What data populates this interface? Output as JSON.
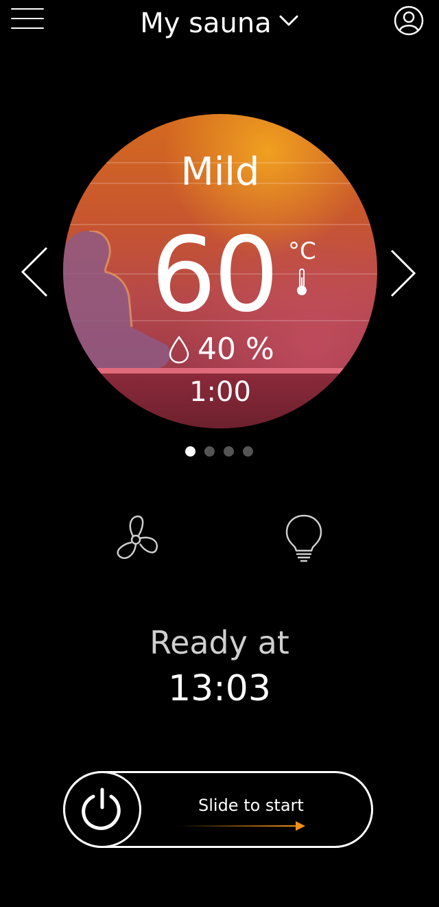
{
  "header": {
    "title": "My sauna",
    "menu_icon": "hamburger-menu-icon",
    "dropdown_icon": "chevron-down-icon",
    "profile_icon": "user-profile-icon"
  },
  "preset": {
    "mode": "Mild",
    "temperature": "60",
    "temperature_unit": "°C",
    "humidity": "40 %",
    "duration": "1:00",
    "page_index": 0,
    "page_count": 4
  },
  "controls": {
    "fan_icon": "fan-icon",
    "light_icon": "light-bulb-icon"
  },
  "status": {
    "ready_label": "Ready at",
    "ready_time": "13:03"
  },
  "slider": {
    "label": "Slide to start",
    "power_icon": "power-icon",
    "accent_color": "#f0901a"
  }
}
